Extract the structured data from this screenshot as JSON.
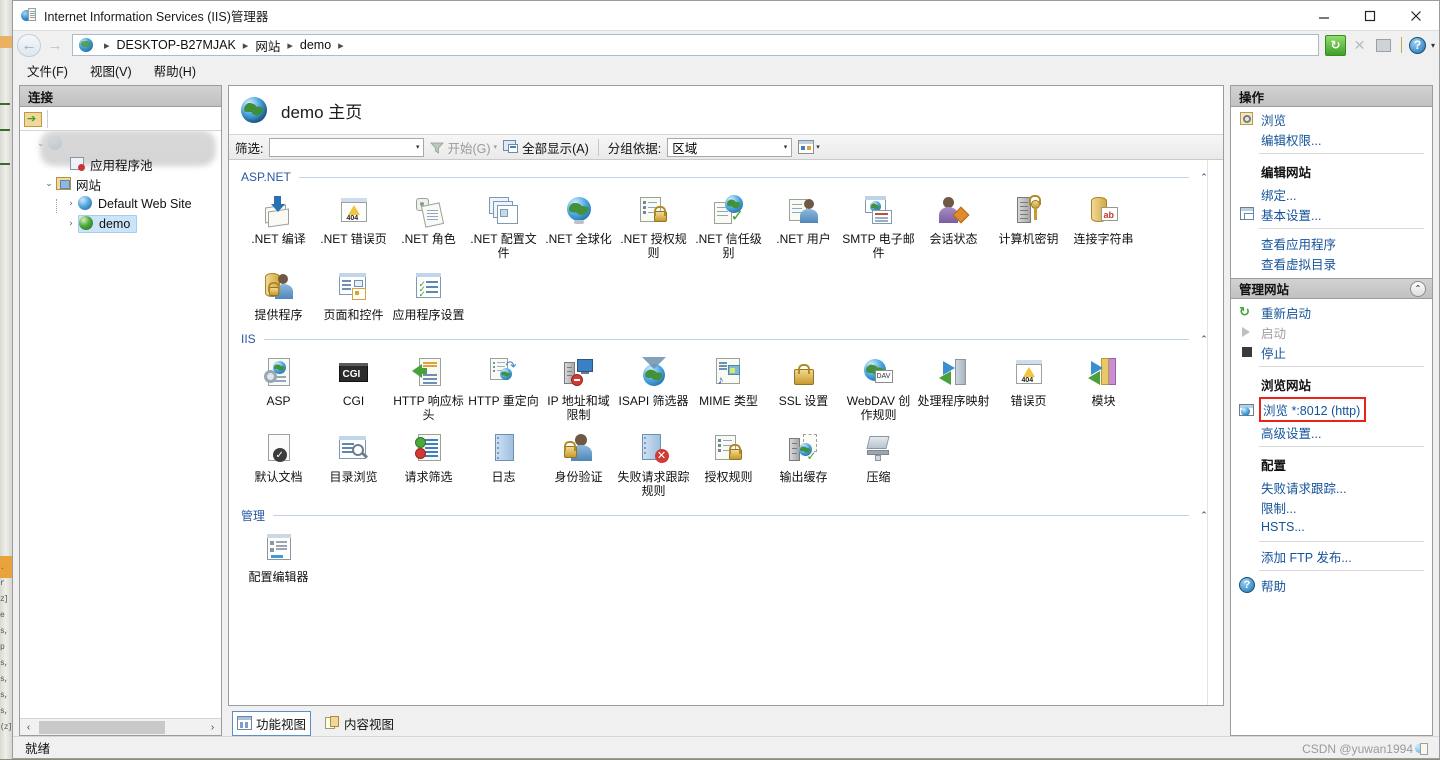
{
  "window": {
    "title": "Internet Information Services (IIS)管理器",
    "icon": "iis-app-icon",
    "minimize_label": "─",
    "maximize_label": "☐",
    "close_label": "✕"
  },
  "address_bar": {
    "back_label": "←",
    "forward_label": "→",
    "crumbs": [
      "DESKTOP-B27MJAK",
      "网站",
      "demo"
    ],
    "separator": "▸",
    "trailing_separator": "▸",
    "tools": {
      "refresh_label": "↻",
      "stop_label": "✕",
      "home_label": "",
      "help_label": "?",
      "help_caret": "▾"
    }
  },
  "menu": {
    "items": [
      "文件(F)",
      "视图(V)",
      "帮助(H)"
    ]
  },
  "connections": {
    "header": "连接",
    "toolbar_icon": "connect-to-server-icon",
    "tree": [
      {
        "label": "",
        "icon": "server-node-icon",
        "twist": "⌄",
        "blurred": true,
        "depth": 0
      },
      {
        "label": "应用程序池",
        "icon": "application-pools-icon",
        "twist": "",
        "depth": 1
      },
      {
        "label": "网站",
        "icon": "sites-folder-icon",
        "twist": "⌄",
        "depth": 1
      },
      {
        "label": "Default Web Site",
        "icon": "web-site-icon",
        "twist": "›",
        "depth": 2
      },
      {
        "label": "demo",
        "icon": "web-site-icon",
        "twist": "›",
        "depth": 2,
        "selected": true
      }
    ],
    "hscroll": {
      "left": "‹",
      "right": "›"
    }
  },
  "main": {
    "page_title": "demo 主页",
    "page_icon": "site-globe-icon",
    "filter_bar": {
      "filter_label": "筛选:",
      "filter_value": "",
      "filter_caret": "▾",
      "go_label": "开始(G)",
      "go_icon": "funnel-icon",
      "go_caret": "▾",
      "show_all_label": "全部显示(A)",
      "show_all_icon": "show-all-icon",
      "group_by_label": "分组依据:",
      "group_by_value": "区域",
      "group_by_caret": "▾",
      "view_icon": "view-mode-icon",
      "view_caret": "▾"
    },
    "groups": [
      {
        "title": "ASP.NET",
        "collapse": "⌃",
        "tiles": [
          {
            "label": ".NET 编译",
            "icon": "net-compilation-icon"
          },
          {
            "label": ".NET 错误页",
            "icon": "net-error-pages-icon"
          },
          {
            "label": ".NET 角色",
            "icon": "net-roles-icon"
          },
          {
            "label": ".NET 配置文件",
            "icon": "net-profile-icon"
          },
          {
            "label": ".NET 全球化",
            "icon": "net-globalization-icon"
          },
          {
            "label": ".NET 授权规则",
            "icon": "net-authorization-rules-icon"
          },
          {
            "label": ".NET 信任级别",
            "icon": "net-trust-levels-icon"
          },
          {
            "label": ".NET 用户",
            "icon": "net-users-icon"
          },
          {
            "label": "SMTP 电子邮件",
            "icon": "smtp-email-icon"
          },
          {
            "label": "会话状态",
            "icon": "session-state-icon"
          },
          {
            "label": "计算机密钥",
            "icon": "machine-key-icon"
          },
          {
            "label": "连接字符串",
            "icon": "connection-strings-icon"
          },
          {
            "label": "提供程序",
            "icon": "providers-icon"
          },
          {
            "label": "页面和控件",
            "icon": "pages-and-controls-icon"
          },
          {
            "label": "应用程序设置",
            "icon": "application-settings-icon"
          }
        ]
      },
      {
        "title": "IIS",
        "collapse": "⌃",
        "tiles": [
          {
            "label": "ASP",
            "icon": "asp-icon"
          },
          {
            "label": "CGI",
            "icon": "cgi-icon"
          },
          {
            "label": "HTTP 响应标头",
            "icon": "http-response-headers-icon"
          },
          {
            "label": "HTTP 重定向",
            "icon": "http-redirect-icon"
          },
          {
            "label": "IP 地址和域限制",
            "icon": "ip-address-domain-restrictions-icon"
          },
          {
            "label": "ISAPI 筛选器",
            "icon": "isapi-filters-icon"
          },
          {
            "label": "MIME 类型",
            "icon": "mime-types-icon"
          },
          {
            "label": "SSL 设置",
            "icon": "ssl-settings-icon"
          },
          {
            "label": "WebDAV 创作规则",
            "icon": "webdav-authoring-rules-icon"
          },
          {
            "label": "处理程序映射",
            "icon": "handler-mappings-icon"
          },
          {
            "label": "错误页",
            "icon": "error-pages-icon"
          },
          {
            "label": "模块",
            "icon": "modules-icon"
          },
          {
            "label": "默认文档",
            "icon": "default-document-icon"
          },
          {
            "label": "目录浏览",
            "icon": "directory-browsing-icon"
          },
          {
            "label": "请求筛选",
            "icon": "request-filtering-icon"
          },
          {
            "label": "日志",
            "icon": "logging-icon"
          },
          {
            "label": "身份验证",
            "icon": "authentication-icon"
          },
          {
            "label": "失败请求跟踪规则",
            "icon": "failed-request-tracing-rules-icon"
          },
          {
            "label": "授权规则",
            "icon": "authorization-rules-icon"
          },
          {
            "label": "输出缓存",
            "icon": "output-caching-icon"
          },
          {
            "label": "压缩",
            "icon": "compression-icon"
          }
        ]
      },
      {
        "title": "管理",
        "collapse": "⌃",
        "tiles": [
          {
            "label": "配置编辑器",
            "icon": "configuration-editor-icon"
          }
        ]
      }
    ],
    "view_tabs": [
      {
        "label": "功能视图",
        "icon": "features-view-icon",
        "active": true
      },
      {
        "label": "内容视图",
        "icon": "content-view-icon",
        "active": false
      }
    ]
  },
  "actions": {
    "header": "操作",
    "items": [
      {
        "label": "浏览",
        "icon": "browse-icon",
        "type": "link"
      },
      {
        "label": "编辑权限...",
        "icon": "",
        "type": "link"
      },
      {
        "type": "divider"
      },
      {
        "label": "编辑网站",
        "type": "group-label"
      },
      {
        "label": "绑定...",
        "icon": "",
        "type": "link"
      },
      {
        "label": "基本设置...",
        "icon": "basic-settings-icon",
        "type": "link"
      },
      {
        "type": "divider"
      },
      {
        "label": "查看应用程序",
        "icon": "",
        "type": "link"
      },
      {
        "label": "查看虚拟目录",
        "icon": "",
        "type": "link"
      }
    ],
    "manage_site": {
      "header": "管理网站",
      "collapse": "⌃",
      "items": [
        {
          "label": "重新启动",
          "icon": "restart-icon",
          "type": "link"
        },
        {
          "label": "启动",
          "icon": "start-icon",
          "type": "link",
          "disabled": true
        },
        {
          "label": "停止",
          "icon": "stop-icon",
          "type": "link"
        },
        {
          "type": "divider"
        },
        {
          "label": "浏览网站",
          "type": "group-label"
        },
        {
          "label": "浏览 *:8012 (http)",
          "icon": "browse-site-icon",
          "type": "link",
          "highlight": true
        },
        {
          "label": "高级设置...",
          "icon": "",
          "type": "link"
        },
        {
          "type": "divider"
        },
        {
          "label": "配置",
          "type": "group-label"
        },
        {
          "label": "失败请求跟踪...",
          "icon": "",
          "type": "link"
        },
        {
          "label": "限制...",
          "icon": "",
          "type": "link"
        },
        {
          "label": "HSTS...",
          "icon": "",
          "type": "link"
        },
        {
          "type": "divider"
        },
        {
          "label": "添加 FTP 发布...",
          "icon": "",
          "type": "link"
        },
        {
          "type": "divider"
        },
        {
          "label": "帮助",
          "icon": "help-icon",
          "type": "link"
        }
      ]
    },
    "highlight_color": "#e8231a"
  },
  "status_bar": {
    "text": "就绪",
    "watermark": "CSDN @yuwan1994"
  }
}
